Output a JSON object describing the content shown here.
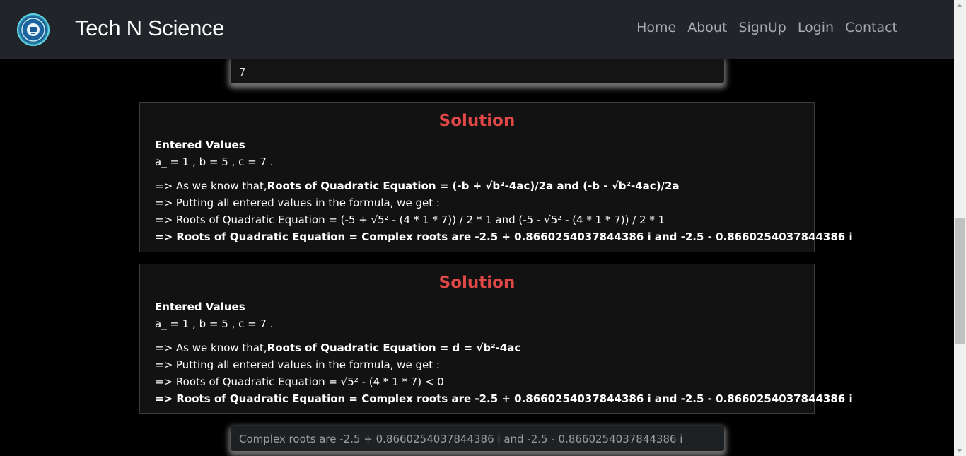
{
  "navbar": {
    "brand": "Tech N Science",
    "links": [
      "Home",
      "About",
      "SignUp",
      "Login",
      "Contact"
    ]
  },
  "input_top": {
    "value": "7"
  },
  "solutions": [
    {
      "title": "Solution",
      "entered_label": "Entered Values",
      "entered_values": "a_ = 1 ,  b = 5 ,  c = 7 .",
      "know_prefix": "=> As we know that,",
      "know_formula": "Roots of Quadratic Equation = (-b + √b²-4ac)/2a and (-b - √b²-4ac)/2a",
      "putting": "=> Putting all entered values in the formula, we get :",
      "substituted": "=> Roots of Quadratic Equation = (-5 + √5² - (4 * 1 * 7)) / 2 * 1 and (-5 - √5² - (4 * 1 * 7)) / 2 * 1",
      "result": "=> Roots of Quadratic Equation = Complex roots are -2.5 + 0.8660254037844386 i and -2.5 - 0.8660254037844386 i"
    },
    {
      "title": "Solution",
      "entered_label": "Entered Values",
      "entered_values": "a_ = 1 ,  b = 5 ,  c = 7 .",
      "know_prefix": "=> As we know that,",
      "know_formula": "Roots of Quadratic Equation = d = √b²-4ac",
      "putting": "=> Putting all entered values in the formula, we get :",
      "substituted": "=> Roots of Quadratic Equation = √5² - (4 * 1 * 7) < 0",
      "result": "=> Roots of Quadratic Equation = Complex roots are -2.5 + 0.8660254037844386 i and -2.5 - 0.8660254037844386 i"
    }
  ],
  "output_bottom": {
    "placeholder": "Complex roots are -2.5 + 0.8660254037844386 i and -2.5 - 0.8660254037844386 i"
  },
  "colors": {
    "navbar_bg": "#212529",
    "solution_title": "#e04747",
    "background": "#000000"
  }
}
